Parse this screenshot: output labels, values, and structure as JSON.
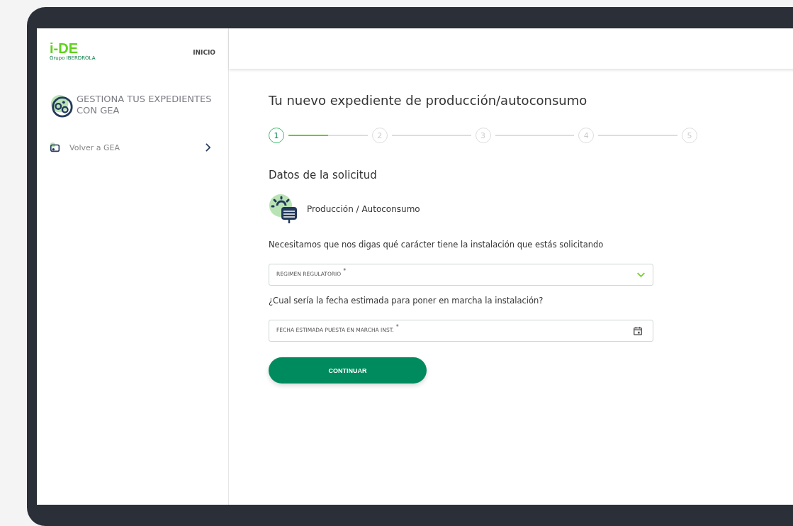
{
  "sidebar": {
    "logo": {
      "wordmark": "i-DE",
      "group": "Grupo IBERDROLA"
    },
    "nav_link": "INICIO",
    "section_title": "GESTIONA TUS EXPEDIENTES CON GEA",
    "items": [
      {
        "label": "Volver a GEA"
      }
    ]
  },
  "main": {
    "title": "Tu nuevo expediente de producción/autoconsumo",
    "steps": [
      {
        "label": "1",
        "selected": true,
        "level": 0.5
      },
      {
        "label": "2",
        "selected": false
      },
      {
        "label": "3",
        "selected": false
      },
      {
        "label": "4",
        "selected": false
      },
      {
        "label": "5",
        "selected": false
      }
    ],
    "section_title": "Datos de la solicitud",
    "category": "Producción / Autoconsumo",
    "fields": [
      {
        "question": "Necesitamos que nos digas qué carácter tiene la instalación que estás solicitando",
        "label": "REGIMEN REGULATORIO",
        "required_mark": "*",
        "kind": "select"
      },
      {
        "question": "¿Cual sería la fecha estimada para poner en marcha la instalación?",
        "label": "FECHA ESTIMADA PUESTA EN MARCHA INST.",
        "required_mark": "*",
        "kind": "date"
      }
    ],
    "button": "CONTINUAR"
  }
}
